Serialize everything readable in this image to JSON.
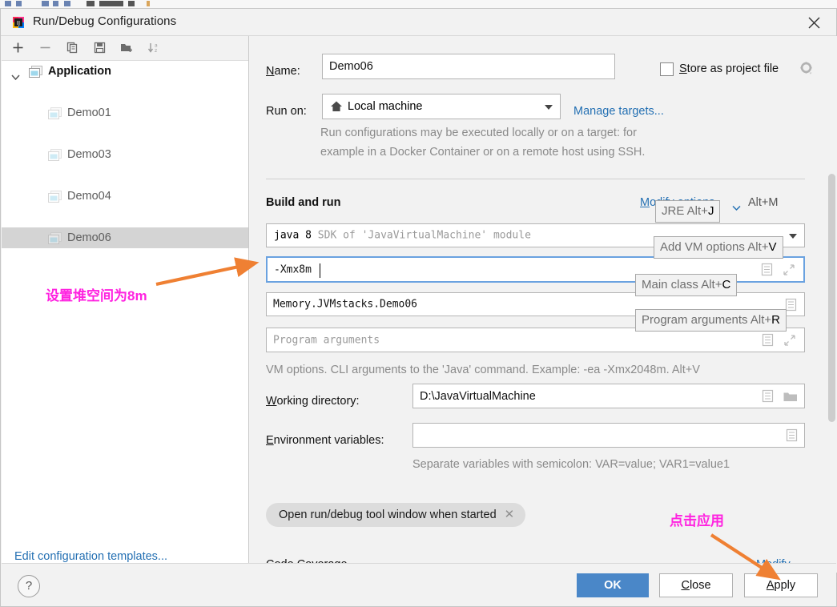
{
  "window": {
    "title": "Run/Debug Configurations",
    "close_icon": "close-icon",
    "app_icon": "intellij-idea-icon"
  },
  "sidebar": {
    "toolbar": [
      {
        "name": "add-configuration-button",
        "icon": "plus-icon"
      },
      {
        "name": "remove-configuration-button",
        "icon": "minus-icon"
      },
      {
        "name": "copy-configuration-button",
        "icon": "copy-icon"
      },
      {
        "name": "save-configuration-button",
        "icon": "save-icon"
      },
      {
        "name": "new-folder-button",
        "icon": "folder-add-icon"
      },
      {
        "name": "sort-configurations-button",
        "icon": "sort-az-icon"
      }
    ],
    "tree": [
      {
        "label": "Application",
        "level": 0,
        "selected": false,
        "expanded": true
      },
      {
        "label": "Demo01",
        "level": 1,
        "selected": false
      },
      {
        "label": "Demo03",
        "level": 1,
        "selected": false
      },
      {
        "label": "Demo04",
        "level": 1,
        "selected": false
      },
      {
        "label": "Demo06",
        "level": 1,
        "selected": true
      }
    ],
    "edit_templates_link": "Edit configuration templates..."
  },
  "form": {
    "name_label": "Name:",
    "name_value": "Demo06",
    "store_as_project_file_label": "Store as project file",
    "store_as_project_file_checked": false,
    "gear_icon": "gear-icon",
    "run_on_label": "Run on:",
    "run_on_value": "Local machine",
    "run_on_icon": "home-icon",
    "manage_targets_link": "Manage targets...",
    "run_on_hint_line1": "Run configurations may be executed locally or on a target: for",
    "run_on_hint_line2": "example in a Docker Container or on a remote host using SSH.",
    "build_and_run_header": "Build and run",
    "modify_options_link": "Modify options",
    "modify_options_shortcut": "Alt+M",
    "jre_value_prefix": "java 8",
    "jre_value_suffix": "SDK of 'JavaVirtualMachine' module",
    "vm_options_value": "-Xmx8m",
    "main_class_value": "Memory.JVMstacks.Demo06",
    "program_arguments_placeholder": "Program arguments",
    "vm_options_hint": "VM options. CLI arguments to the 'Java' command. Example: -ea -Xmx2048m. Alt+V",
    "working_directory_label": "Working directory:",
    "working_directory_value": "D:\\JavaVirtualMachine",
    "environment_variables_label": "Environment variables:",
    "environment_variables_value": "",
    "environment_hint": "Separate variables with semicolon: VAR=value; VAR1=value1",
    "open_tool_window_chip": "Open run/debug tool window when started",
    "chip_remove_icon": "close-small-icon",
    "code_coverage_header": "Code Coverage",
    "code_coverage_modify_link": "Modify"
  },
  "tooltips": [
    {
      "text": "JRE Alt+",
      "key": "J",
      "name": "tooltip-jre"
    },
    {
      "text": "Add VM options Alt+",
      "key": "V",
      "name": "tooltip-add-vm-options"
    },
    {
      "text": "Main class Alt+",
      "key": "C",
      "name": "tooltip-main-class"
    },
    {
      "text": "Program arguments Alt+",
      "key": "R",
      "name": "tooltip-program-arguments"
    }
  ],
  "footer": {
    "help_label": "?",
    "ok_label": "OK",
    "close_label": "Close",
    "apply_label": "Apply"
  },
  "annotations": [
    {
      "text": "设置堆空间为8m",
      "name": "annotation-set-heap",
      "color": "#ff22e0"
    },
    {
      "text": "点击应用",
      "name": "annotation-click-apply",
      "color": "#ff22e0"
    }
  ],
  "colors": {
    "accent_blue": "#4a87c8",
    "link_blue": "#2470b3",
    "annotation_magenta": "#ff22e0",
    "arrow_orange": "#ef8033",
    "selection_gray": "#d4d4d4",
    "focus_border": "#6aa2e0"
  }
}
